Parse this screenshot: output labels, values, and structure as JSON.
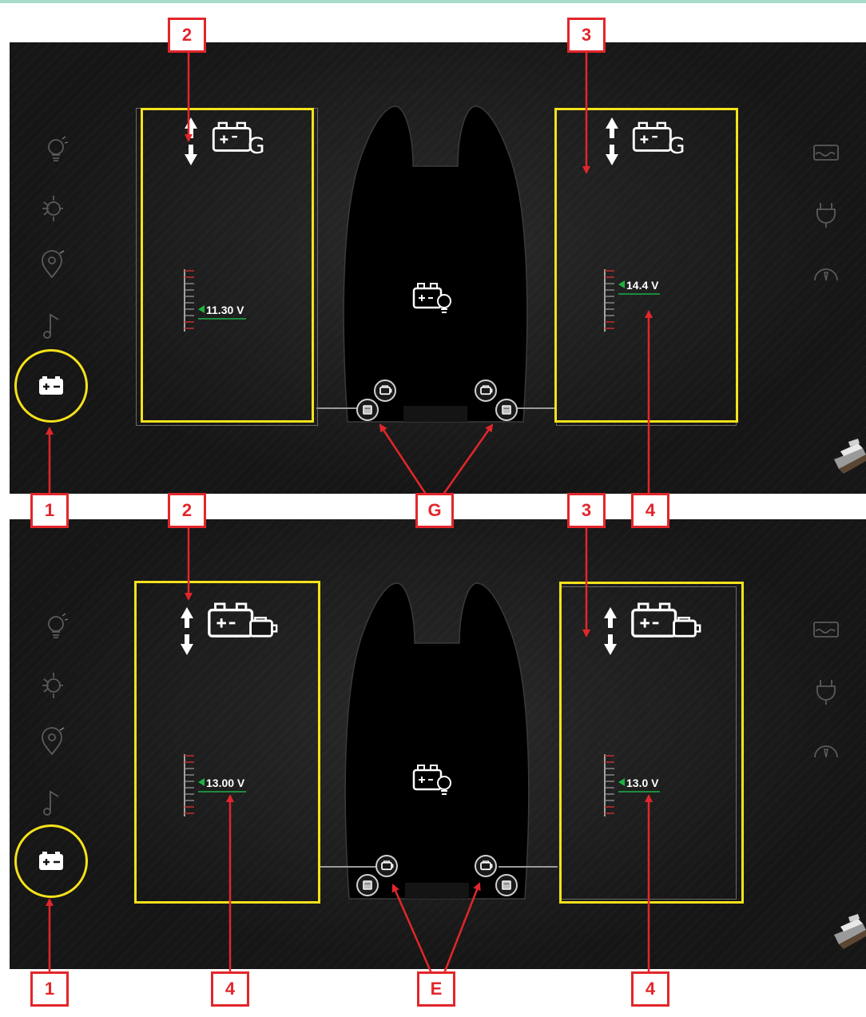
{
  "colors": {
    "highlight": "#f5e21b",
    "callout": "#e2262b",
    "voltage_marker": "#20b040",
    "panel_background": "#141414"
  },
  "top_panel": {
    "left_battery": {
      "icon": "battery-generator-icon",
      "voltage": "11.30 V"
    },
    "right_battery": {
      "icon": "battery-generator-icon",
      "voltage": "14.4 V"
    },
    "center_icon": "battery-lighting-icon",
    "selected_sidebar": "battery-icon"
  },
  "bottom_panel": {
    "left_battery": {
      "icon": "battery-engine-icon",
      "voltage": "13.00 V"
    },
    "right_battery": {
      "icon": "battery-engine-icon",
      "voltage": "13.0 V"
    },
    "center_icon": "battery-lighting-icon",
    "selected_sidebar": "battery-icon"
  },
  "left_sidebar_icons": [
    "lightbulb-icon",
    "climate-icon",
    "navigation-icon",
    "music-icon",
    "battery-icon"
  ],
  "right_sidebar_icons": [
    "tank-icon",
    "shore-power-icon",
    "gauge-icon"
  ],
  "callouts": {
    "top": [
      "2",
      "3"
    ],
    "middle": [
      "1",
      "2",
      "G",
      "3",
      "4"
    ],
    "bottom": [
      "1",
      "4",
      "E",
      "4"
    ]
  }
}
